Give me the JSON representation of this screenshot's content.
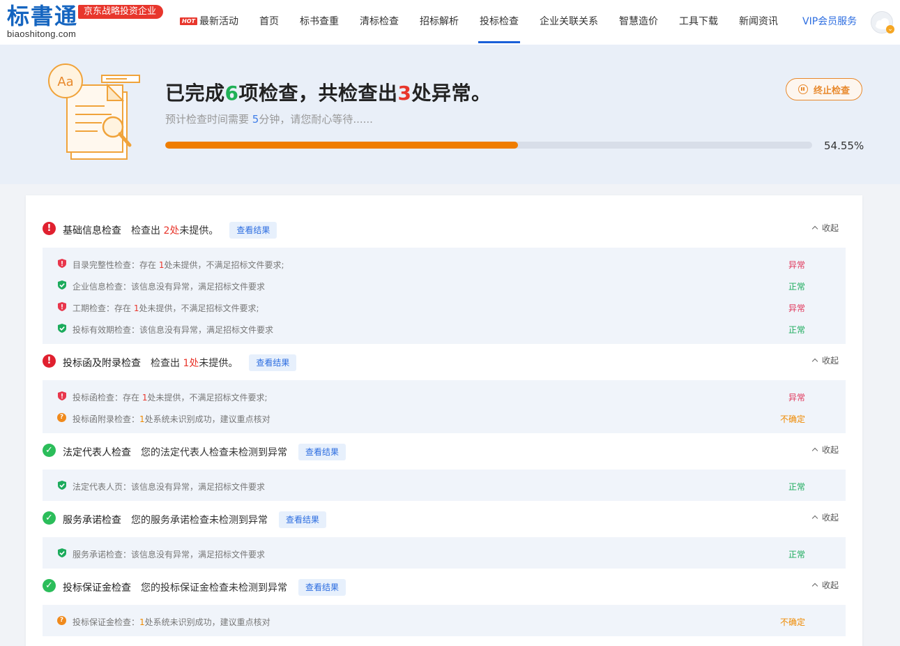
{
  "brand": {
    "logo_text": "标書通",
    "domain": "biaoshitong.com",
    "badge": "京东战略投资企业"
  },
  "nav": {
    "hot_tag": "HOT",
    "items": [
      "最新活动",
      "首页",
      "标书查重",
      "清标检查",
      "招标解析",
      "投标检查",
      "企业关联关系",
      "智慧造价",
      "工具下载",
      "新闻资讯",
      "VIP会员服务"
    ],
    "active": "投标检查"
  },
  "banner": {
    "headline_p1": "已完成",
    "done_count": "6",
    "headline_p2": "项检查，共检查出",
    "issue_count": "3",
    "headline_p3": "处异常。",
    "sub_p1": "预计检查时间需要 ",
    "minutes": "5",
    "sub_p2": "分钟，请您耐心等待......",
    "progress_percent": 54.55,
    "progress_text": "54.55%",
    "stop_label": "终止检查",
    "illus_label": "Aa"
  },
  "common": {
    "view_result": "查看结果",
    "collapse": "收起"
  },
  "colors": {
    "accent_blue": "#2c6de0",
    "progress_orange": "#ef7d00",
    "error_red": "#e0202f",
    "ok_green": "#2bbd5a",
    "warn_orange": "#f08a1c"
  },
  "sections": [
    {
      "title": "基础信息检查",
      "status": "error",
      "summary_p1": "检查出 ",
      "summary_count": "2处",
      "summary_p2": "未提供。",
      "items": [
        {
          "status": "bad",
          "text_p1": "目录完整性检查：存在 ",
          "count": "1",
          "text_p2": "处未提供，不满足招标文件要求;",
          "label": "异常"
        },
        {
          "status": "ok",
          "text_p1": "企业信息检查：该信息没有异常，满足招标文件要求",
          "count": "",
          "text_p2": "",
          "label": "正常"
        },
        {
          "status": "bad",
          "text_p1": "工期检查：存在 ",
          "count": "1",
          "text_p2": "处未提供，不满足招标文件要求;",
          "label": "异常"
        },
        {
          "status": "ok",
          "text_p1": "投标有效期检查：该信息没有异常，满足招标文件要求",
          "count": "",
          "text_p2": "",
          "label": "正常"
        }
      ]
    },
    {
      "title": "投标函及附录检查",
      "status": "error",
      "summary_p1": "检查出 ",
      "summary_count": "1处",
      "summary_p2": "未提供。",
      "items": [
        {
          "status": "bad",
          "text_p1": "投标函检查：存在 ",
          "count": "1",
          "text_p2": "处未提供，不满足招标文件要求;",
          "label": "异常"
        },
        {
          "status": "unk",
          "text_p1": "投标函附录检查：",
          "count": "1",
          "text_p2": "处系统未识别成功，建议重点核对",
          "label": "不确定"
        }
      ]
    },
    {
      "title": "法定代表人检查",
      "status": "ok",
      "summary_p1": "您的法定代表人检查未检测到异常",
      "summary_count": "",
      "summary_p2": "",
      "items": [
        {
          "status": "ok",
          "text_p1": "法定代表人页：该信息没有异常，满足招标文件要求",
          "count": "",
          "text_p2": "",
          "label": "正常"
        }
      ]
    },
    {
      "title": "服务承诺检查",
      "status": "ok",
      "summary_p1": "您的服务承诺检查未检测到异常",
      "summary_count": "",
      "summary_p2": "",
      "items": [
        {
          "status": "ok",
          "text_p1": "服务承诺检查：该信息没有异常，满足招标文件要求",
          "count": "",
          "text_p2": "",
          "label": "正常"
        }
      ]
    },
    {
      "title": "投标保证金检查",
      "status": "ok",
      "summary_p1": "您的投标保证金检查未检测到异常",
      "summary_count": "",
      "summary_p2": "",
      "items": [
        {
          "status": "unk",
          "text_p1": "投标保证金检查：",
          "count": "1",
          "text_p2": "处系统未识别成功，建议重点核对",
          "label": "不确定"
        }
      ]
    }
  ]
}
